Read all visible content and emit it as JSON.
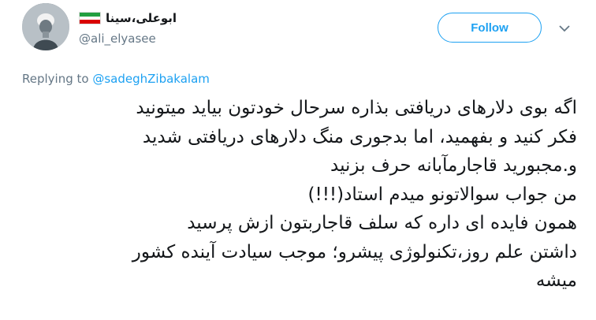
{
  "author": {
    "display_name": "ابوعلی،سینا",
    "handle": "@ali_elyasee",
    "flag_colors": [
      "#239f40",
      "#ffffff",
      "#da0000"
    ]
  },
  "actions": {
    "follow_label": "Follow"
  },
  "reply": {
    "prefix": "Replying to ",
    "mention": "@sadeghZibakalam"
  },
  "tweet": {
    "lines": [
      "اگه بوی دلارهای دریافتی بذاره سرحال خودتون بیاید میتونید",
      "فکر کنید و بفهمید، اما بدجوری منگ دلارهای دریافتی شدید",
      "و.مجبورید قاجارمآبانه حرف بزنید",
      "من جواب سوالاتونو میدم استاد(!!!)",
      "همون فایده ای داره که سلف قاجاربتون ازش پرسید",
      "داشتن علم روز،تکنولوژی پیشرو؛ موجب سیادت آینده کشور",
      "میشه"
    ]
  },
  "colors": {
    "accent": "#1da1f2",
    "secondary_text": "#657786",
    "primary_text": "#14171a"
  }
}
